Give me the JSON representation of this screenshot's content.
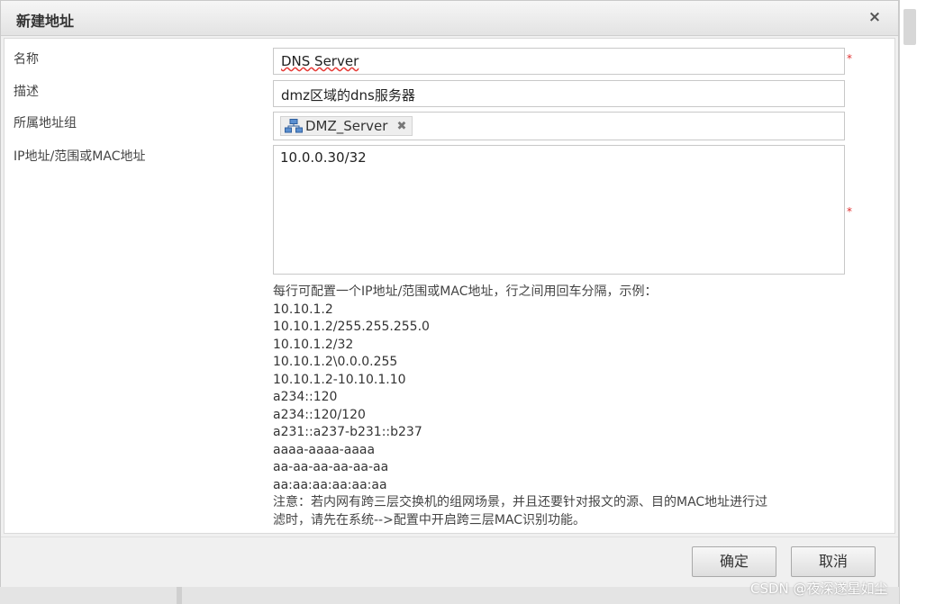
{
  "dialog": {
    "title": "新建地址",
    "close_symbol": "×"
  },
  "form": {
    "name_label": "名称",
    "name_value": "DNS Server",
    "desc_label": "描述",
    "desc_value": "dmz区域的dns服务器",
    "group_label": "所属地址组",
    "group_tag": "DMZ_Server",
    "group_tag_remove": "✖",
    "ip_label": "IP地址/范围或MAC地址",
    "ip_value": "10.0.0.30/32",
    "required_mark": "*"
  },
  "help": {
    "intro": "每行可配置一个IP地址/范围或MAC地址，行之间用回车分隔，示例：",
    "examples": [
      "10.10.1.2",
      "10.10.1.2/255.255.255.0",
      "10.10.1.2/32",
      "10.10.1.2\\0.0.0.255",
      "10.10.1.2-10.10.1.10",
      "a234::120",
      "a234::120/120",
      "a231::a237-b231::b237",
      "aaaa-aaaa-aaaa",
      "aa-aa-aa-aa-aa-aa",
      "aa:aa:aa:aa:aa:aa"
    ],
    "note_line1": "注意：若内网有跨三层交换机的组网场景，并且还要针对报文的源、目的MAC地址进行过",
    "note_line2": "滤时，请先在系统-->配置中开启跨三层MAC识别功能。"
  },
  "buttons": {
    "ok": "确定",
    "cancel": "取消"
  },
  "watermark": "CSDN @夜深遂星如尘",
  "icons": {
    "group_tag_icon": "network-group-icon"
  }
}
